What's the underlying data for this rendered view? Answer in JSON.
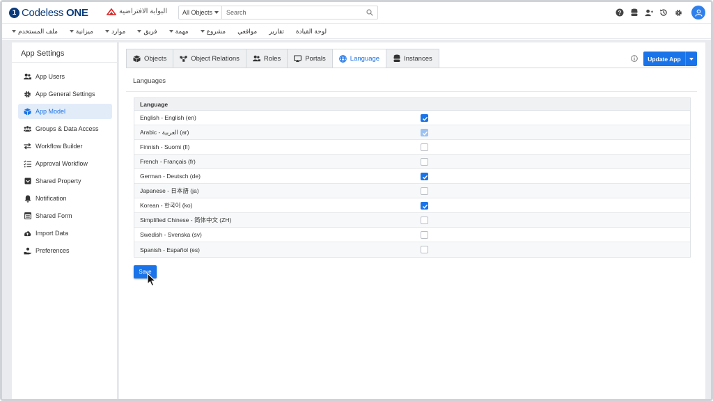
{
  "header": {
    "logo_mark": "1",
    "logo_text": "Codeless",
    "logo_text_bold": "ONE",
    "portal_name": "البوابة الافتراضية",
    "search_scope": "All Objects",
    "search_placeholder": "Search"
  },
  "nav": {
    "items": [
      {
        "label": "لوحة القيادة",
        "dropdown": false
      },
      {
        "label": "تقارير",
        "dropdown": false
      },
      {
        "label": "مواقعي",
        "dropdown": false
      },
      {
        "label": "مشروع",
        "dropdown": true
      },
      {
        "label": "مهمة",
        "dropdown": true
      },
      {
        "label": "فريق",
        "dropdown": true
      },
      {
        "label": "موارد",
        "dropdown": true
      },
      {
        "label": "ميزانية",
        "dropdown": true
      },
      {
        "label": "ملف المستخدم",
        "dropdown": true
      }
    ]
  },
  "sidebar": {
    "title": "App Settings",
    "items": [
      {
        "label": "App Users",
        "icon": "users-icon",
        "active": false
      },
      {
        "label": "App General Settings",
        "icon": "gear-icon",
        "active": false
      },
      {
        "label": "App Model",
        "icon": "cube-icon",
        "active": true
      },
      {
        "label": "Groups & Data Access",
        "icon": "group-icon",
        "active": false
      },
      {
        "label": "Workflow Builder",
        "icon": "arrows-icon",
        "active": false
      },
      {
        "label": "Approval Workflow",
        "icon": "checklist-icon",
        "active": false
      },
      {
        "label": "Shared Property",
        "icon": "inbox-icon",
        "active": false
      },
      {
        "label": "Notification",
        "icon": "bell-icon",
        "active": false
      },
      {
        "label": "Shared Form",
        "icon": "form-icon",
        "active": false
      },
      {
        "label": "Import Data",
        "icon": "cloud-upload-icon",
        "active": false
      },
      {
        "label": "Preferences",
        "icon": "hand-user-icon",
        "active": false
      }
    ]
  },
  "tabs": [
    {
      "label": "Objects",
      "icon": "cube-icon",
      "active": false
    },
    {
      "label": "Object Relations",
      "icon": "relations-icon",
      "active": false
    },
    {
      "label": "Roles",
      "icon": "users-icon",
      "active": false
    },
    {
      "label": "Portals",
      "icon": "monitor-icon",
      "active": false
    },
    {
      "label": "Language",
      "icon": "globe-icon",
      "active": true
    },
    {
      "label": "Instances",
      "icon": "database-icon",
      "active": false
    }
  ],
  "toolbar": {
    "update_label": "Update App"
  },
  "languages": {
    "section_title": "Languages",
    "column_header": "Language",
    "rows": [
      {
        "label": "English - English (en)",
        "checked": true,
        "disabled": false
      },
      {
        "label": "Arabic - العربية (ar)",
        "checked": true,
        "disabled": true
      },
      {
        "label": "Finnish - Suomi (fi)",
        "checked": false,
        "disabled": false
      },
      {
        "label": "French - Français (fr)",
        "checked": false,
        "disabled": false
      },
      {
        "label": "German - Deutsch (de)",
        "checked": true,
        "disabled": false
      },
      {
        "label": "Japanese - 日本語 (ja)",
        "checked": false,
        "disabled": false
      },
      {
        "label": "Korean - 한국어 (ko)",
        "checked": true,
        "disabled": false
      },
      {
        "label": "Simplified Chinese - 简体中文 (ZH)",
        "checked": false,
        "disabled": false
      },
      {
        "label": "Swedish - Svenska (sv)",
        "checked": false,
        "disabled": false
      },
      {
        "label": "Spanish - Español (es)",
        "checked": false,
        "disabled": false
      }
    ],
    "save_label": "Save"
  },
  "colors": {
    "accent": "#1a73e8",
    "brand": "#0a3a7a",
    "active_bg": "#e2ecf9"
  }
}
